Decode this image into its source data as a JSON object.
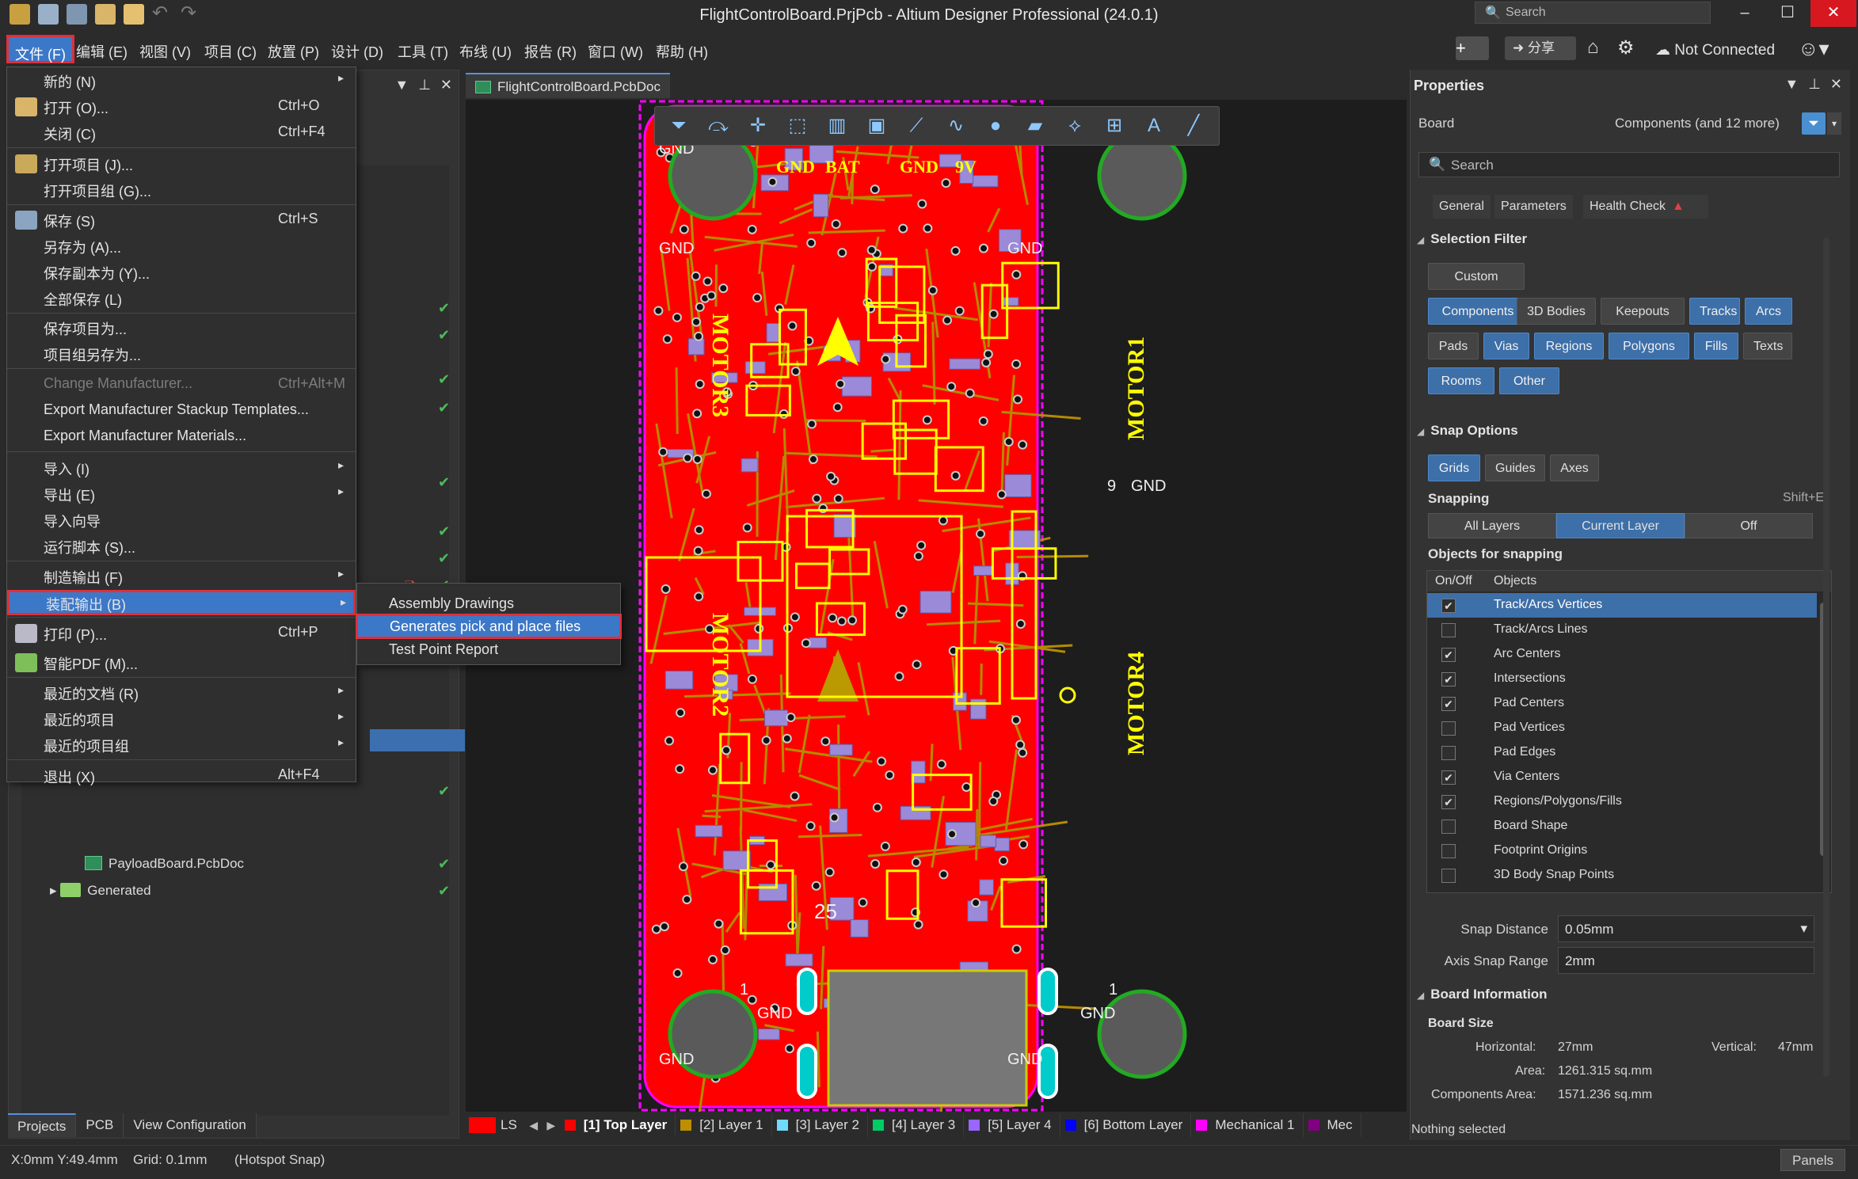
{
  "window": {
    "title": "FlightControlBoard.PrjPcb - Altium Designer Professional (24.0.1)",
    "search_placeholder": "Search",
    "minimize": "–",
    "maximize": "☐",
    "close": "✕"
  },
  "menubar": {
    "items": [
      "文件 (F)",
      "编辑 (E)",
      "视图 (V)",
      "项目 (C)",
      "放置 (P)",
      "设计 (D)",
      "工具 (T)",
      "布线 (U)",
      "报告 (R)",
      "窗口 (W)",
      "帮助 (H)"
    ],
    "share_label": "分享",
    "not_connected": "Not Connected"
  },
  "file_menu": {
    "items": [
      {
        "label": "新的 (N)",
        "shortcut": "",
        "arrow": "▸"
      },
      {
        "label": "打开 (O)...",
        "shortcut": "Ctrl+O",
        "arrow": ""
      },
      {
        "label": "关闭 (C)",
        "shortcut": "Ctrl+F4",
        "arrow": ""
      },
      {
        "label": "打开项目 (J)...",
        "shortcut": "",
        "arrow": ""
      },
      {
        "label": "打开项目组 (G)...",
        "shortcut": "",
        "arrow": ""
      },
      {
        "label": "保存 (S)",
        "shortcut": "Ctrl+S",
        "arrow": ""
      },
      {
        "label": "另存为 (A)...",
        "shortcut": "",
        "arrow": ""
      },
      {
        "label": "保存副本为 (Y)...",
        "shortcut": "",
        "arrow": ""
      },
      {
        "label": "全部保存 (L)",
        "shortcut": "",
        "arrow": ""
      },
      {
        "label": "保存项目为...",
        "shortcut": "",
        "arrow": ""
      },
      {
        "label": "项目组另存为...",
        "shortcut": "",
        "arrow": ""
      },
      {
        "label": "Change Manufacturer...",
        "shortcut": "Ctrl+Alt+M",
        "arrow": ""
      },
      {
        "label": "Export Manufacturer Stackup Templates...",
        "shortcut": "",
        "arrow": ""
      },
      {
        "label": "Export Manufacturer Materials...",
        "shortcut": "",
        "arrow": ""
      },
      {
        "label": "导入 (I)",
        "shortcut": "",
        "arrow": "▸"
      },
      {
        "label": "导出 (E)",
        "shortcut": "",
        "arrow": "▸"
      },
      {
        "label": "导入向导",
        "shortcut": "",
        "arrow": ""
      },
      {
        "label": "运行脚本 (S)...",
        "shortcut": "",
        "arrow": ""
      },
      {
        "label": "制造输出 (F)",
        "shortcut": "",
        "arrow": "▸"
      },
      {
        "label": "装配输出 (B)",
        "shortcut": "",
        "arrow": "▸"
      },
      {
        "label": "打印 (P)...",
        "shortcut": "Ctrl+P",
        "arrow": ""
      },
      {
        "label": "智能PDF (M)...",
        "shortcut": "",
        "arrow": ""
      },
      {
        "label": "最近的文档 (R)",
        "shortcut": "",
        "arrow": "▸"
      },
      {
        "label": "最近的项目",
        "shortcut": "",
        "arrow": "▸"
      },
      {
        "label": "最近的项目组",
        "shortcut": "",
        "arrow": "▸"
      },
      {
        "label": "退出 (X)",
        "shortcut": "Alt+F4",
        "arrow": ""
      }
    ]
  },
  "submenu": {
    "items": [
      "Assembly Drawings",
      "Generates pick and place files",
      "Test Point Report"
    ]
  },
  "projects_panel": {
    "tree": [
      {
        "label": "PayloadBoard.PcbDoc",
        "kind": "pcb"
      },
      {
        "label": "Generated",
        "kind": "folder"
      }
    ],
    "tabs": [
      "Projects",
      "PCB",
      "View Configuration"
    ]
  },
  "document": {
    "tab_label": "FlightControlBoard.PcbDoc",
    "silk_top": [
      "GND",
      "BAT",
      "GND",
      "9V"
    ],
    "silk_motor": [
      "MOTOR3",
      "MOTOR1",
      "MOTOR2",
      "MOTOR4"
    ],
    "silk_gnd": "GND",
    "silk_misc": [
      "9",
      "25",
      "1"
    ]
  },
  "layers": {
    "ls_label": "LS",
    "items": [
      {
        "label": "[1] Top Layer",
        "color": "#ff0000",
        "active": true
      },
      {
        "label": "[2] Layer 1",
        "color": "#bc8e00",
        "active": false
      },
      {
        "label": "[3] Layer 2",
        "color": "#70dbfa",
        "active": false
      },
      {
        "label": "[4] Layer 3",
        "color": "#00cc66",
        "active": false
      },
      {
        "label": "[5] Layer 4",
        "color": "#9966ff",
        "active": false
      },
      {
        "label": "[6] Bottom Layer",
        "color": "#0000ff",
        "active": false
      },
      {
        "label": "Mechanical 1",
        "color": "#ff00ff",
        "active": false
      },
      {
        "label": "Mec",
        "color": "#800080",
        "active": false
      }
    ]
  },
  "properties": {
    "title": "Properties",
    "board_label": "Board",
    "components_label": "Components (and 12 more)",
    "search_placeholder": "Search",
    "tabs": [
      "General",
      "Parameters",
      "Health Check"
    ],
    "selection_filter": {
      "heading": "Selection Filter",
      "custom": "Custom",
      "buttons": [
        {
          "label": "Components",
          "on": true
        },
        {
          "label": "3D Bodies",
          "on": false
        },
        {
          "label": "Keepouts",
          "on": false
        },
        {
          "label": "Tracks",
          "on": true
        },
        {
          "label": "Arcs",
          "on": true
        },
        {
          "label": "Pads",
          "on": false
        },
        {
          "label": "Vias",
          "on": true
        },
        {
          "label": "Regions",
          "on": true
        },
        {
          "label": "Polygons",
          "on": true
        },
        {
          "label": "Fills",
          "on": true
        },
        {
          "label": "Texts",
          "on": false
        },
        {
          "label": "Rooms",
          "on": true
        },
        {
          "label": "Other",
          "on": true
        }
      ]
    },
    "snap_options": {
      "heading": "Snap Options",
      "buttons": [
        {
          "label": "Grids",
          "on": true
        },
        {
          "label": "Guides",
          "on": false
        },
        {
          "label": "Axes",
          "on": false
        }
      ],
      "snapping_label": "Snapping",
      "snapping_shortcut": "Shift+E",
      "snapping_modes": [
        {
          "label": "All Layers",
          "on": false
        },
        {
          "label": "Current Layer",
          "on": true
        },
        {
          "label": "Off",
          "on": false
        }
      ],
      "objects_heading": "Objects for snapping",
      "col_onoff": "On/Off",
      "col_objects": "Objects",
      "objects": [
        {
          "label": "Track/Arcs Vertices",
          "checked": true,
          "selected": true
        },
        {
          "label": "Track/Arcs Lines",
          "checked": false,
          "selected": false
        },
        {
          "label": "Arc Centers",
          "checked": true,
          "selected": false
        },
        {
          "label": "Intersections",
          "checked": true,
          "selected": false
        },
        {
          "label": "Pad Centers",
          "checked": true,
          "selected": false
        },
        {
          "label": "Pad Vertices",
          "checked": false,
          "selected": false
        },
        {
          "label": "Pad Edges",
          "checked": false,
          "selected": false
        },
        {
          "label": "Via Centers",
          "checked": true,
          "selected": false
        },
        {
          "label": "Regions/Polygons/Fills",
          "checked": true,
          "selected": false
        },
        {
          "label": "Board Shape",
          "checked": false,
          "selected": false
        },
        {
          "label": "Footprint Origins",
          "checked": false,
          "selected": false
        },
        {
          "label": "3D Body Snap Points",
          "checked": false,
          "selected": false
        }
      ],
      "snap_distance_label": "Snap Distance",
      "snap_distance_value": "0.05mm",
      "axis_snap_label": "Axis Snap Range",
      "axis_snap_value": "2mm"
    },
    "board_info": {
      "heading": "Board Information",
      "size_heading": "Board Size",
      "horizontal_label": "Horizontal:",
      "horizontal_value": "27mm",
      "vertical_label": "Vertical:",
      "vertical_value": "47mm",
      "area_label": "Area:",
      "area_value": "1261.315 sq.mm",
      "comp_area_label": "Components Area:",
      "comp_area_value": "1571.236 sq.mm"
    },
    "nothing_selected": "Nothing selected"
  },
  "status": {
    "coords": "X:0mm Y:49.4mm",
    "grid": "Grid: 0.1mm",
    "snap": "(Hotspot Snap)",
    "panels": "Panels"
  },
  "colors": {
    "accent": "#3c78c8",
    "highlight_border": "#e0303a",
    "pcb_copper": "#ff0000",
    "silkscreen": "#ffff00"
  }
}
